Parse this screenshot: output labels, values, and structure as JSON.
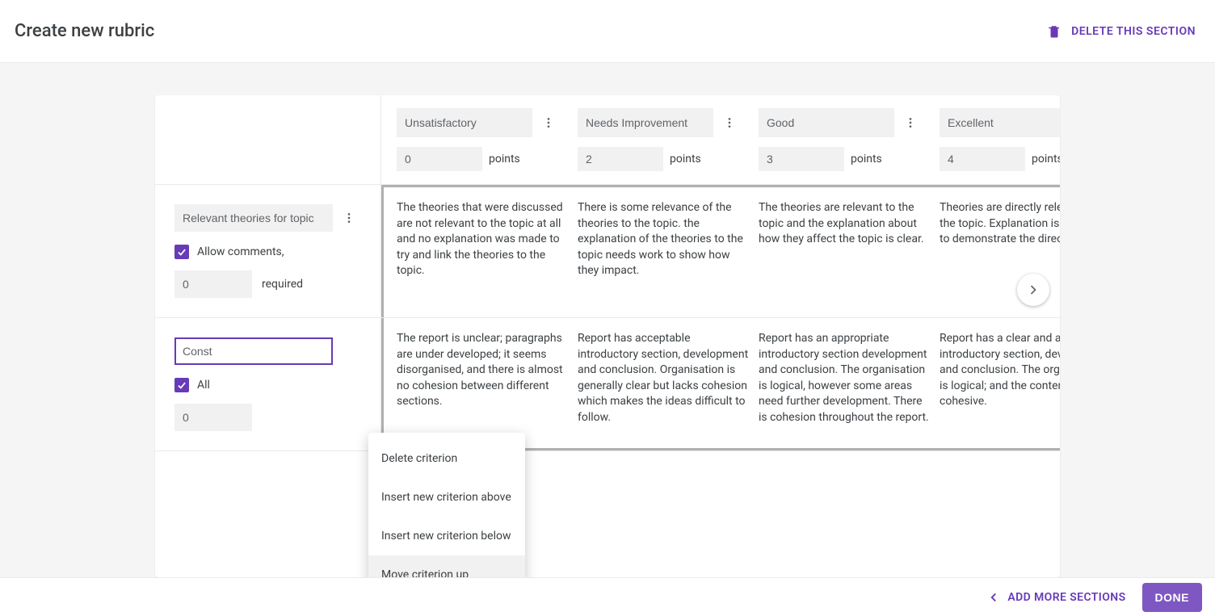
{
  "header": {
    "title": "Create new rubric",
    "delete_section_label": "DELETE THIS SECTION"
  },
  "levels": [
    {
      "name": "Unsatisfactory",
      "points": "0"
    },
    {
      "name": "Needs Improvement",
      "points": "2"
    },
    {
      "name": "Good",
      "points": "3"
    },
    {
      "name": "Excellent",
      "points": "4"
    }
  ],
  "points_suffix": "points",
  "criteria": [
    {
      "title": "Relevant theories for topic",
      "allow_comments_label": "Allow comments,",
      "allow_comments_checked": true,
      "required_value": "0",
      "required_label": "required",
      "descriptions": [
        "The theories that were discussed are not relevant to the topic at all and no explanation was made to try and link the theories to the topic.",
        "There is some relevance of the theories to the topic.  the explanation of the theories to the topic needs work to show how they impact.",
        "The theories are relevant to the topic and the explanation about how they affect the topic is clear.",
        "Theories are directly relevant to the topic.  Explanation is provided to demonstrate the direct affect."
      ]
    },
    {
      "title": "Const",
      "allow_comments_label": "All",
      "allow_comments_checked": true,
      "required_value": "0",
      "required_label": "",
      "descriptions": [
        "The report is unclear; paragraphs are under developed; it seems disorganised, and there is almost no cohesion between different sections.",
        "Report has acceptable introductory section, development and conclusion. Organisation is generally clear but lacks cohesion which makes the ideas difficult to follow.",
        "Report has an appropriate introductory section development and conclusion. The organisation is logical, however some areas need further development. There is cohesion throughout the report.",
        "Report has a clear and appropriate introductory section, development and conclusion. The organisation is logical; and the content is cohesive."
      ]
    }
  ],
  "context_menu": {
    "items": [
      "Delete criterion",
      "Insert new criterion above",
      "Insert new criterion below",
      "Move criterion up"
    ]
  },
  "footer": {
    "add_more_label": "ADD MORE SECTIONS",
    "done_label": "DONE"
  },
  "icons": {
    "trash": "trash-icon",
    "kebab": "more-vert-icon",
    "check": "check-icon",
    "chevron_right": "chevron-right-icon",
    "chevron_left": "chevron-left-icon"
  }
}
